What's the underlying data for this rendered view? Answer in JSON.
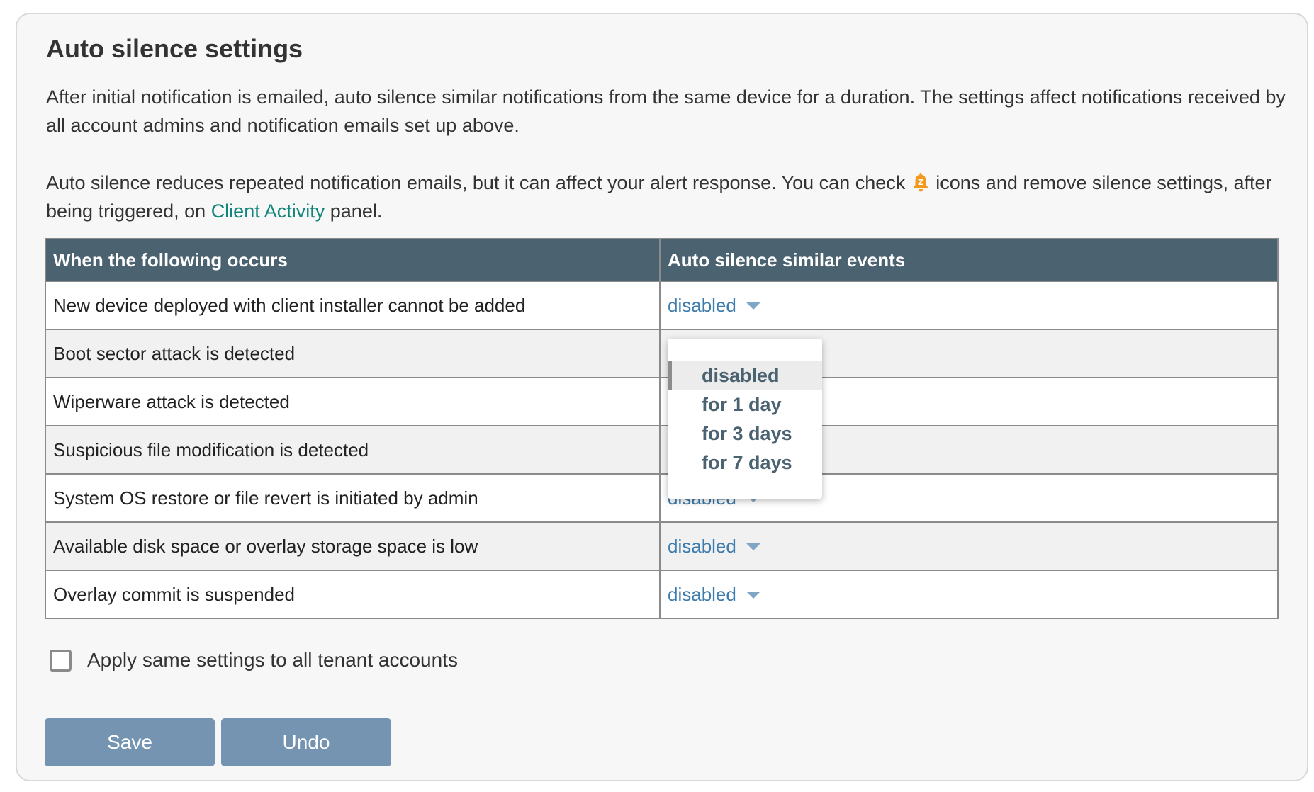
{
  "section": {
    "title": "Auto silence settings",
    "description": "After initial notification is emailed, auto silence similar notifications from the same device for a duration. The settings affect notifications received by all account admins and notification emails set up above.",
    "note_part1": "Auto silence reduces repeated notification emails, but it can affect your alert response. You can check",
    "note_part2": "icons and remove silence settings, after being triggered, on",
    "note_link": "Client Activity",
    "note_part3": "panel.",
    "bell_badge": "Z",
    "accent_color": "#12857a",
    "bell_color": "#f39a1e"
  },
  "table": {
    "headers": [
      "When the following occurs",
      "Auto silence similar events"
    ],
    "rows": [
      {
        "event": "New device deployed with client installer cannot be added",
        "value": "disabled"
      },
      {
        "event": "Boot sector attack is detected",
        "value": "disabled"
      },
      {
        "event": "Wiperware attack is detected",
        "value": "disabled"
      },
      {
        "event": "Suspicious file modification is detected",
        "value": "disabled"
      },
      {
        "event": "System OS restore or file revert is initiated by admin",
        "value": "disabled"
      },
      {
        "event": "Available disk space or overlay storage space is low",
        "value": "disabled"
      },
      {
        "event": "Overlay commit is suspended",
        "value": "disabled"
      }
    ],
    "header_bg": "#4b6270"
  },
  "dropdown": {
    "options": [
      "disabled",
      "for 1 day",
      "for 3 days",
      "for 7 days"
    ],
    "selected_index": 0
  },
  "apply_all": {
    "label": "Apply same settings to all tenant accounts",
    "checked": false
  },
  "buttons": {
    "save": "Save",
    "undo": "Undo",
    "color": "#7494b1"
  }
}
